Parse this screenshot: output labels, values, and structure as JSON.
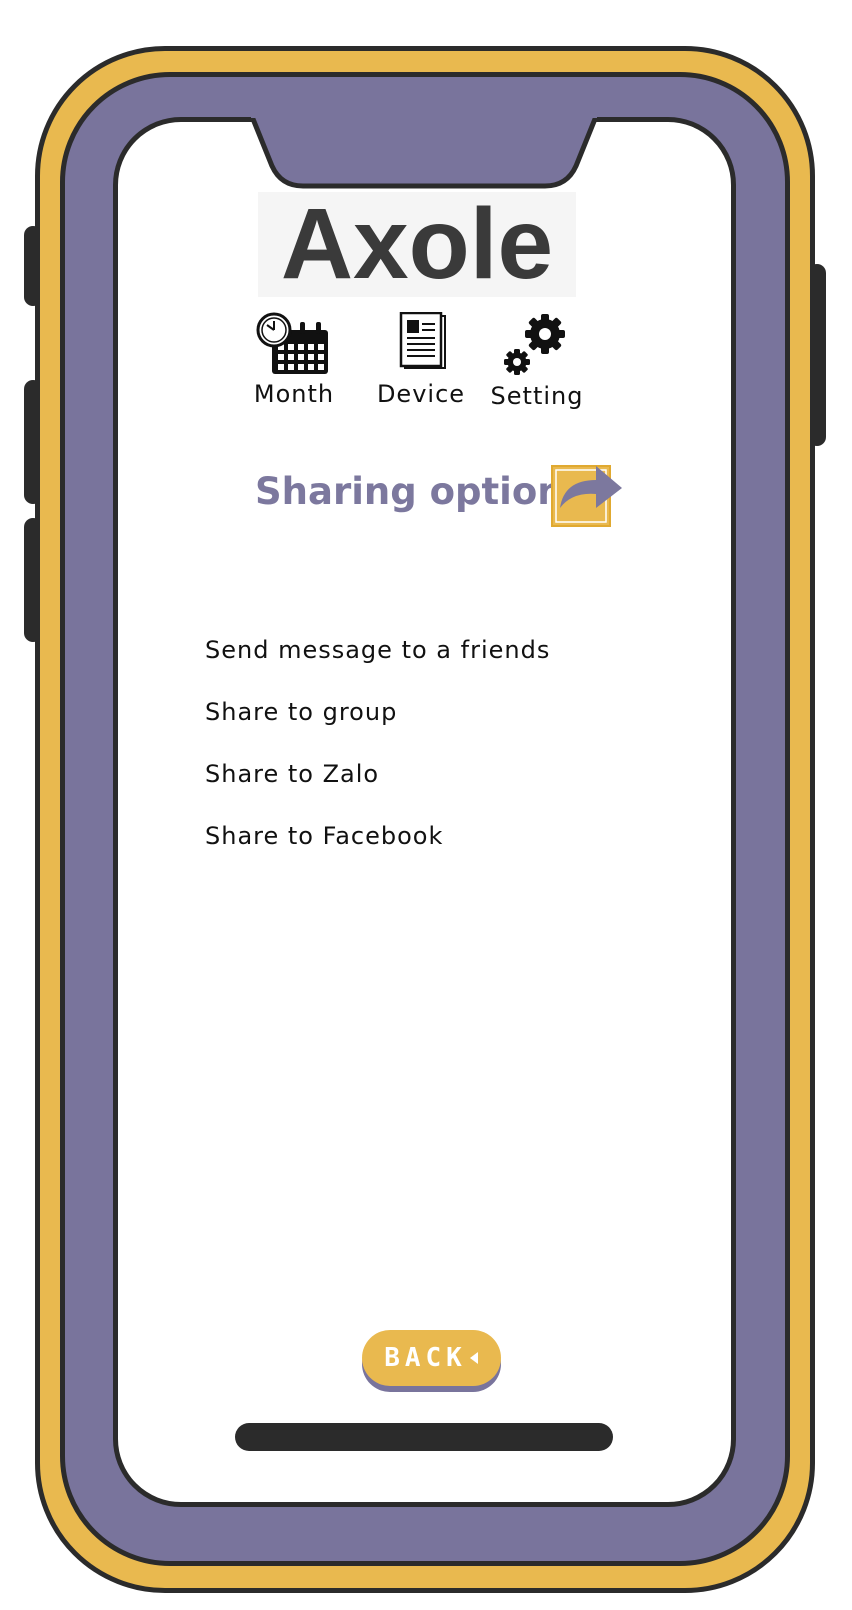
{
  "app": {
    "logo_text": "Axole"
  },
  "nav": {
    "items": [
      {
        "label": "Month",
        "icon": "calendar-clock-icon"
      },
      {
        "label": "Device",
        "icon": "document-icon"
      },
      {
        "label": "Setting",
        "icon": "gears-icon"
      }
    ]
  },
  "sharing": {
    "title": "Sharing option",
    "icon": "share-arrow-icon",
    "options": [
      "Send message to a friends",
      "Share to group",
      "Share to Zalo",
      "Share to Facebook"
    ]
  },
  "footer": {
    "back_label": "BACK"
  },
  "colors": {
    "accent_yellow": "#e9b94f",
    "accent_purple": "#79749c",
    "frame_dark": "#2b2b2b"
  }
}
